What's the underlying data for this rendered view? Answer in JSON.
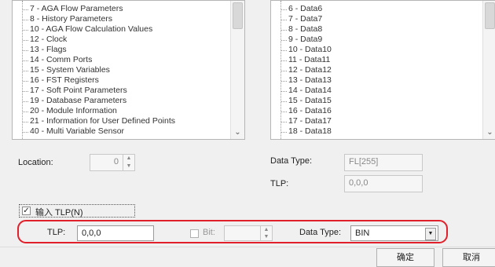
{
  "left_list": {
    "items": [
      "7 - AGA Flow Parameters",
      "8 - History Parameters",
      "10 - AGA Flow Calculation Values",
      "12 - Clock",
      "13 - Flags",
      "14 - Comm Ports",
      "15 - System Variables",
      "16 - FST Registers",
      "17 - Soft Point Parameters",
      "19 - Database Parameters",
      "20 - Module Information",
      "21 - Information for User Defined Points",
      "40 - Multi Variable Sensor"
    ]
  },
  "right_list": {
    "items": [
      "6 - Data6",
      "7 - Data7",
      "8 - Data8",
      "9 - Data9",
      "10 - Data10",
      "11 - Data11",
      "12 - Data12",
      "13 - Data13",
      "14 - Data14",
      "15 - Data15",
      "16 - Data16",
      "17 - Data17",
      "18 - Data18"
    ]
  },
  "location": {
    "label": "Location:",
    "value": "0"
  },
  "data_type_info": {
    "label": "Data Type:",
    "value": "FL[255]"
  },
  "tlp_info": {
    "label": "TLP:",
    "value": "0,0,0"
  },
  "input_tlp": {
    "checkbox_label": "输入 TLP(N)",
    "checked": true
  },
  "tlp_entry": {
    "tlp_label": "TLP:",
    "tlp_value": "0,0,0",
    "bit_label": "Bit:",
    "bit_value": "",
    "data_type_label": "Data Type:",
    "data_type_value": "BIN"
  },
  "buttons": {
    "ok": "确定",
    "cancel": "取消"
  },
  "colors": {
    "highlight": "#e0202a"
  }
}
